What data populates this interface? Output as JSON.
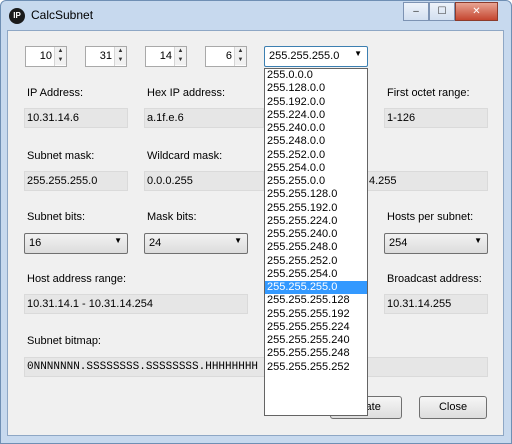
{
  "window": {
    "title": "CalcSubnet",
    "icon_text": "IP"
  },
  "octets": [
    "10",
    "31",
    "14",
    "6"
  ],
  "fields": {
    "ip_address": {
      "label": "IP Address:",
      "value": "10.31.14.6"
    },
    "hex_ip": {
      "label": "Hex IP address:",
      "value": "a.1f.e.6"
    },
    "first_octet": {
      "label": "First octet range:",
      "value": "1-126"
    },
    "subnet_mask": {
      "label": "Subnet mask:",
      "value": "255.255.255.0"
    },
    "wildcard_mask": {
      "label": "Wildcard mask:",
      "value": "0.0.0.255"
    },
    "hidden_partial": {
      "value": "4.255"
    },
    "subnet_bits": {
      "label": "Subnet bits:",
      "value": "16"
    },
    "mask_bits": {
      "label": "Mask bits:",
      "value": "24"
    },
    "hosts_per_subnet": {
      "label": "Hosts per subnet:",
      "value": "254"
    },
    "host_range": {
      "label": "Host address range:",
      "value": "10.31.14.1 - 10.31.14.254"
    },
    "broadcast": {
      "label": "Broadcast address:",
      "value": "10.31.14.255"
    },
    "bitmap": {
      "label": "Subnet bitmap:",
      "value": "0NNNNNNN.SSSSSSSS.SSSSSSSS.HHHHHHHH"
    }
  },
  "mask_combo": {
    "value": "255.255.255.0"
  },
  "mask_options": [
    "255.0.0.0",
    "255.128.0.0",
    "255.192.0.0",
    "255.224.0.0",
    "255.240.0.0",
    "255.248.0.0",
    "255.252.0.0",
    "255.254.0.0",
    "255.255.0.0",
    "255.255.128.0",
    "255.255.192.0",
    "255.255.224.0",
    "255.255.240.0",
    "255.255.248.0",
    "255.255.252.0",
    "255.255.254.0",
    "255.255.255.0",
    "255.255.255.128",
    "255.255.255.192",
    "255.255.255.224",
    "255.255.255.240",
    "255.255.255.248",
    "255.255.255.252"
  ],
  "selected_option_index": 16,
  "buttons": {
    "calculate": "ulate",
    "close": "Close"
  }
}
